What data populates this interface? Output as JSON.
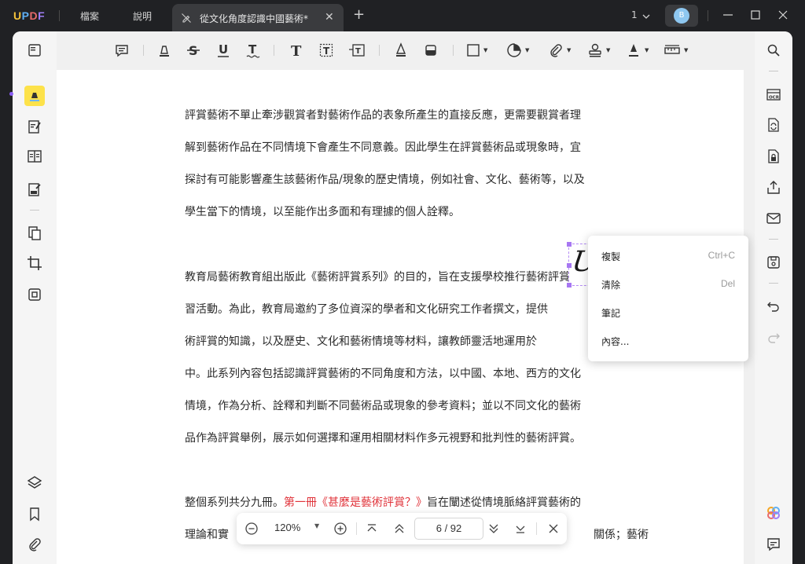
{
  "app": {
    "logo_letters": [
      "U",
      "P",
      "D",
      "F"
    ],
    "logo_colors": [
      "#f5c33b",
      "#5fb0f5",
      "#e86a6a",
      "#a07ff6"
    ]
  },
  "menu": {
    "file": "檔案",
    "help": "說明"
  },
  "tab": {
    "title": "從文化角度認識中國藝術*"
  },
  "titlebar": {
    "page_count": "1",
    "avatar_initial": "B",
    "avatar_color": "#8ec7f0"
  },
  "colors": {
    "accent_yellow": "#fde24a",
    "selection_purple": "#a777f2",
    "link_red": "#e0333a"
  },
  "toolbar": {
    "tools": [
      "comment-icon",
      "highlight-icon",
      "strikethrough-icon",
      "underline-icon",
      "squiggly-icon",
      "text-icon",
      "textbox-icon",
      "callout-icon",
      "pencil-icon",
      "eraser-icon",
      "shape-icon",
      "sticker-icon",
      "attachment-icon",
      "stamp-icon",
      "signature-icon",
      "measure-icon"
    ]
  },
  "document": {
    "paragraphs": [
      [
        "評賞藝術不單止牽涉觀賞者對藝術作品的表象所產生的直接反應，更需要觀賞者理",
        "解到藝術作品在不同情境下會產生不同意義。因此學生在評賞藝術品或現象時，宜",
        "探討有可能影響產生該藝術作品/現象的歷史情境，例如社會、文化、藝術等，以及",
        "學生當下的情境，以至能作出多面和有理據的個人詮釋。"
      ],
      [
        "教育局藝術教育組出版此《藝術評賞系列》的目的，旨在支援學校推行藝術評賞",
        "習活動。為此，教育局邀約了多位資深的學者和文化研究工作者撰文，提供",
        "術評賞的知識，以及歷史、文化和藝術情境等材料，讓教師靈活地運用於",
        "中。此系列內容包括認識評賞藝術的不同角度和方法，以中國、本地、西方的文化",
        "情境，作為分析、詮釋和判斷不同藝術品或現象的參考資料；並以不同文化的藝術",
        "品作為評賞舉例，展示如何選擇和運用相關材料作多元視野和批判性的藝術評賞。"
      ]
    ],
    "para3": {
      "line1_a": "整個系列共分九冊。",
      "line1_link": "第一冊《甚麼是藝術評賞？》",
      "line1_b": "旨在闡述從情境脈絡評賞藝術的",
      "line2_a": "理論和實",
      "line2_b": "關係；藝術評"
    },
    "signature_text": "UPDF"
  },
  "context_menu": {
    "items": [
      {
        "label": "複製",
        "shortcut": "Ctrl+C"
      },
      {
        "label": "清除",
        "shortcut": "Del"
      },
      {
        "label": "筆記",
        "shortcut": ""
      },
      {
        "label": "內容...",
        "shortcut": ""
      }
    ]
  },
  "navbar": {
    "zoom": "120%",
    "current_page": "6",
    "total_pages": "92",
    "page_display": "6 / 92"
  }
}
